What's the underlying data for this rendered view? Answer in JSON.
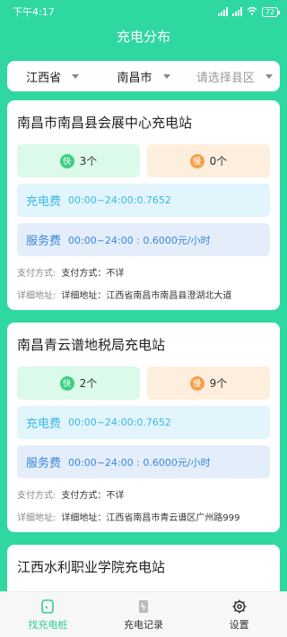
{
  "status": {
    "time": "下午4:17",
    "battery": "72"
  },
  "header": {
    "title": "充电分布"
  },
  "filter": {
    "province": "江西省",
    "city": "南昌市",
    "district_placeholder": "请选择县区"
  },
  "stations": [
    {
      "name": "南昌市南昌县会展中心充电站",
      "fast_badge": "快",
      "fast_count": "3个",
      "slow_badge": "慢",
      "slow_count": "0个",
      "charge_label": "充电费",
      "charge_value": "00:00~24:00:0.7652",
      "service_label": "服务费",
      "service_value": "00:00~24:00 : 0.6000元/小时",
      "pay_key": "支付方式:",
      "pay_value": "支付方式：不详",
      "addr_key": "详细地址:",
      "addr_value": "详细地址：江西省南昌市南昌县澄湖北大道"
    },
    {
      "name": "南昌青云谱地税局充电站",
      "fast_badge": "快",
      "fast_count": "2个",
      "slow_badge": "慢",
      "slow_count": "9个",
      "charge_label": "充电费",
      "charge_value": "00:00~24:00:0.7652",
      "service_label": "服务费",
      "service_value": "00:00~24:00 : 0.6000元/小时",
      "pay_key": "支付方式:",
      "pay_value": "支付方式：不详",
      "addr_key": "详细地址:",
      "addr_value": "详细地址：江西省南昌市青云谱区广州路999"
    },
    {
      "name": "江西水利职业学院充电站"
    }
  ],
  "tabs": [
    {
      "label": "找充电桩",
      "icon": "charger-search-icon"
    },
    {
      "label": "充电记录",
      "icon": "record-icon"
    },
    {
      "label": "设置",
      "icon": "gear-icon"
    }
  ],
  "colors": {
    "accent": "#2ed8a0",
    "fast": "#3ecf83",
    "slow": "#f4a04a",
    "charge": "#3ab8e6",
    "service": "#3b86d8"
  }
}
